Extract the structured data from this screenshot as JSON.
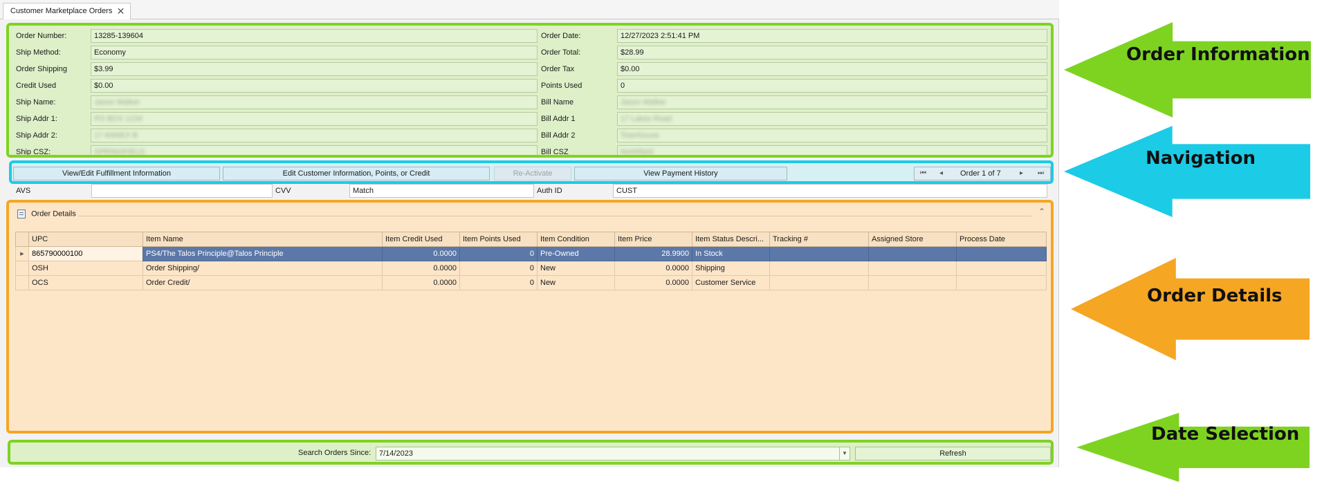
{
  "tab": {
    "title": "Customer Marketplace Orders",
    "close": "✕"
  },
  "order_info": {
    "left": [
      {
        "label": "Order Number:",
        "value": "13285-139604"
      },
      {
        "label": "Ship Method:",
        "value": "Economy"
      },
      {
        "label": "Order Shipping",
        "value": "$3.99"
      },
      {
        "label": "Credit Used",
        "value": "$0.00"
      },
      {
        "label": "Ship Name:",
        "value": "Jason Walker"
      },
      {
        "label": "Ship Addr 1:",
        "value": "PO BOX 1234"
      },
      {
        "label": "Ship Addr 2:",
        "value": "17 ANNEX B"
      },
      {
        "label": "Ship CSZ:",
        "value": "SPRINGFIELD"
      }
    ],
    "right": [
      {
        "label": "Order Date:",
        "value": "12/27/2023 2:51:41 PM"
      },
      {
        "label": "Order Total:",
        "value": "$28.99"
      },
      {
        "label": "Order Tax",
        "value": "$0.00"
      },
      {
        "label": "Points Used",
        "value": "0"
      },
      {
        "label": "Bill Name",
        "value": "Jason Walker"
      },
      {
        "label": "Bill Addr 1",
        "value": "17 Lakes Road"
      },
      {
        "label": "Bill Addr 2",
        "value": "Townhouse"
      },
      {
        "label": "Bill CSZ",
        "value": "Northfield"
      }
    ]
  },
  "navigation": {
    "fulfillment": "View/Edit Fulfillment Information",
    "customer": "Edit Customer Information, Points, or Credit",
    "reactivate": "Re-Activate",
    "payment_history": "View Payment History",
    "pager": {
      "first": "⏮",
      "prev": "◂",
      "text": "Order 1 of 7",
      "next": "▸",
      "last": "⏭"
    }
  },
  "avs_row": {
    "avs_label": "AVS",
    "avs_value": "",
    "cvv_label": "CVV",
    "cvv_value": "Match",
    "auth_label": "Auth ID",
    "auth_value": "CUST"
  },
  "order_details": {
    "header": "Order Details",
    "columns": [
      "UPC",
      "Item Name",
      "Item Credit Used",
      "Item Points Used",
      "Item Condition",
      "Item Price",
      "Item Status Descri...",
      "Tracking #",
      "Assigned Store",
      "Process Date"
    ],
    "rows": [
      {
        "upc": "865790000100",
        "name": "PS4/The Talos Principle@Talos Principle",
        "credit": "0.0000",
        "points": "0",
        "condition": "Pre-Owned",
        "price": "28.9900",
        "status": "In Stock",
        "tracking": "",
        "store": "",
        "date": ""
      },
      {
        "upc": "OSH",
        "name": "Order Shipping/",
        "credit": "0.0000",
        "points": "0",
        "condition": "New",
        "price": "0.0000",
        "status": "Shipping",
        "tracking": "",
        "store": "",
        "date": ""
      },
      {
        "upc": "OCS",
        "name": "Order Credit/",
        "credit": "0.0000",
        "points": "0",
        "condition": "New",
        "price": "0.0000",
        "status": "Customer Service",
        "tracking": "",
        "store": "",
        "date": ""
      }
    ],
    "selected_row": 0
  },
  "date_selection": {
    "label": "Search Orders Since:",
    "value": "7/14/2023",
    "refresh": "Refresh"
  },
  "annotations": [
    {
      "text": "Order Information",
      "color": "#7ed321"
    },
    {
      "text": "Navigation",
      "color": "#1ccbe6"
    },
    {
      "text": "Order Details",
      "color": "#f5a623"
    },
    {
      "text": "Date Selection",
      "color": "#7ed321"
    }
  ],
  "colors": {
    "order_info_bg": "#ddf0c8",
    "order_info_border": "#7ed321",
    "navigation_bg": "#d6f0f4",
    "navigation_border": "#1ccbe6",
    "details_bg": "#fde5c8",
    "details_border": "#f5a623",
    "selected_row": "#5b78a8"
  }
}
